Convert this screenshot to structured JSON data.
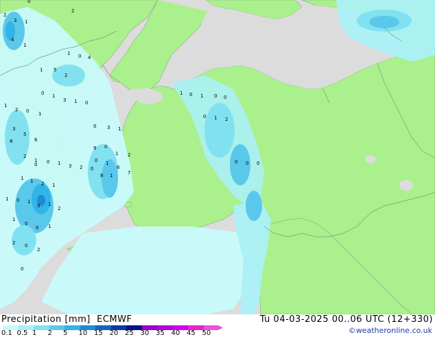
{
  "footer": {
    "title": "Precipitation [mm]  ECMWF",
    "datetime": "Tu 04-03-2025 00..06 UTC (12+330)",
    "credit": "©weatheronline.co.uk"
  },
  "legend": {
    "labels": [
      "0.1",
      "0.5",
      "1",
      "2",
      "5",
      "10",
      "15",
      "20",
      "25",
      "30",
      "35",
      "40",
      "45",
      "50"
    ],
    "colors": [
      "#c8fafa",
      "#aaf0f5",
      "#82e1f0",
      "#5ac8eb",
      "#32b4e6",
      "#1e8cd2",
      "#1464be",
      "#0a3ca0",
      "#00148c",
      "#9600c8",
      "#b400dc",
      "#d200f0",
      "#e628c8",
      "#f050dc"
    ]
  },
  "map_colors": {
    "land": "#aaf08c",
    "sea": "#dcdcdc",
    "border": "#7d9a7d"
  },
  "precip_values": [
    "2",
    "3",
    "1",
    "4",
    "1",
    "2",
    "0",
    "1",
    "4",
    "0",
    "1",
    "2",
    "5",
    "0",
    "1",
    "3",
    "1",
    "0",
    "1",
    "2",
    "0",
    "1",
    "3",
    "5",
    "6",
    "8",
    "2",
    "1",
    "0",
    "3",
    "1",
    "9",
    "0",
    "1",
    "2",
    "0",
    "1",
    "6",
    "7",
    "8",
    "1",
    "0",
    "2",
    "3",
    "1",
    "0",
    "0",
    "1",
    "1",
    "2",
    "1",
    "1",
    "0",
    "1",
    "0",
    "1",
    "2",
    "1",
    "0",
    "0",
    "1",
    "2",
    "0",
    "2",
    "0",
    "1",
    "0",
    "1",
    "0",
    "0",
    "0",
    "1",
    "2",
    "0",
    "0",
    "0"
  ]
}
